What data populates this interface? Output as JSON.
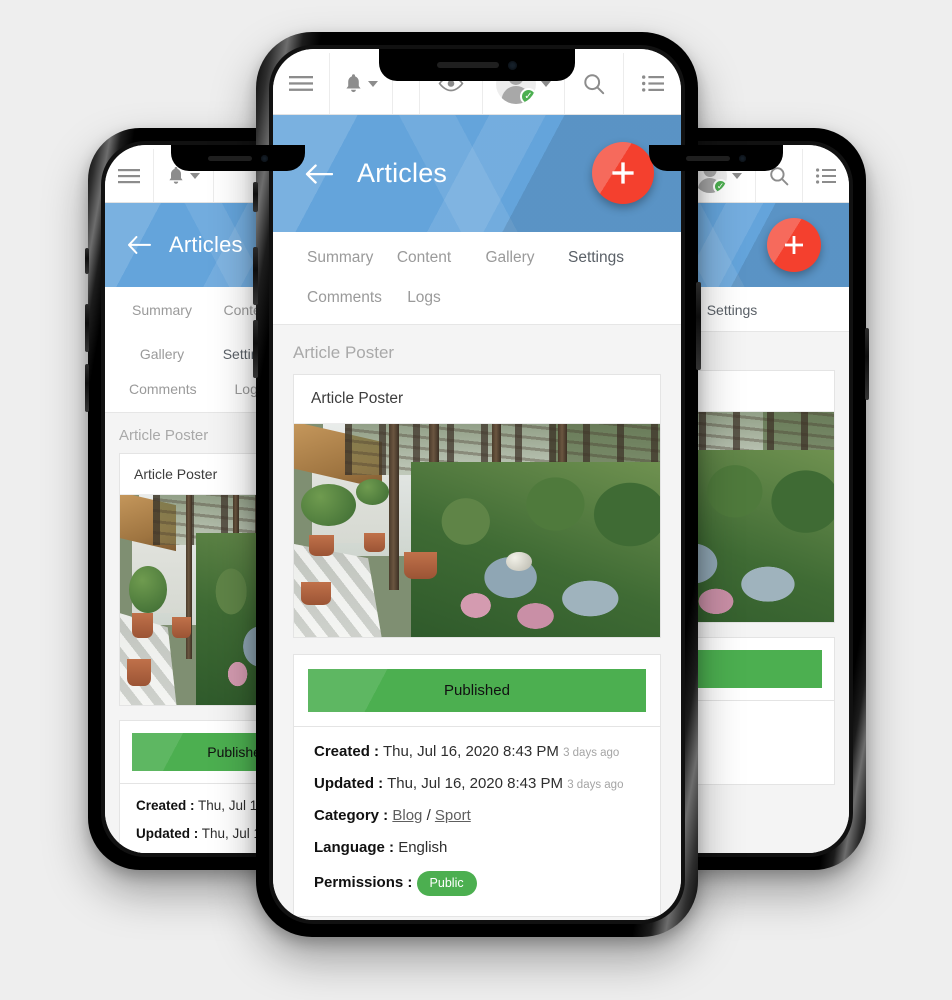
{
  "background_color": "#eeeeee",
  "colors": {
    "hero_blue": "#64a4db",
    "fab_red": "#f4402e",
    "status_green": "#4caf50",
    "muted_text": "#9a9a9a"
  },
  "appbar": {
    "menu_icon": "hamburger-menu-icon",
    "notifications_icon": "bell-icon",
    "notifications_caret": "chevron-down-icon",
    "preview_icon": "eye-icon",
    "avatar_icon": "user-avatar-icon",
    "avatar_verified_badge": "✓",
    "avatar_caret": "chevron-down-icon",
    "search_icon": "search-icon",
    "list_icon": "list-icon"
  },
  "hero": {
    "back_icon": "arrow-left-icon",
    "title": "Articles",
    "fab_label": "+",
    "fab_icon": "plus-icon"
  },
  "tabs": [
    {
      "label": "Summary",
      "active": false
    },
    {
      "label": "Content",
      "active": false
    },
    {
      "label": "Gallery",
      "active": false
    },
    {
      "label": "Settings",
      "active": true
    },
    {
      "label": "Comments",
      "active": false
    },
    {
      "label": "Logs",
      "active": false
    }
  ],
  "content": {
    "section_label": "Article Poster",
    "card_title": "Article Poster",
    "photo_alt": "garden-walkway-photo",
    "status": "Published",
    "meta": [
      {
        "label": "Created :",
        "value": "Thu, Jul 16, 2020 8:43 PM",
        "ago": "3 days ago"
      },
      {
        "label": "Updated :",
        "value": "Thu, Jul 16, 2020 8:43 PM",
        "ago": "3 days ago"
      },
      {
        "label": "Category :",
        "links": [
          "Blog",
          "Sport"
        ],
        "separator": "/"
      },
      {
        "label": "Language :",
        "value": "English"
      },
      {
        "label": "Permissions :",
        "pill": "Public"
      }
    ],
    "meta_rows": {
      "created_label": "Created :",
      "created_value": "Thu, Jul 16, 2020 8:43 PM",
      "created_ago": "3 days ago",
      "updated_label": "Updated :",
      "updated_value": "Thu, Jul 16, 2020 8:43 PM",
      "updated_ago": "3 days ago",
      "category_label": "Category :",
      "category_link_1": "Blog",
      "category_separator": "/",
      "category_link_2": "Sport",
      "language_label": "Language :",
      "language_value": "English",
      "permissions_label": "Permissions :",
      "permissions_pill": "Public"
    }
  }
}
